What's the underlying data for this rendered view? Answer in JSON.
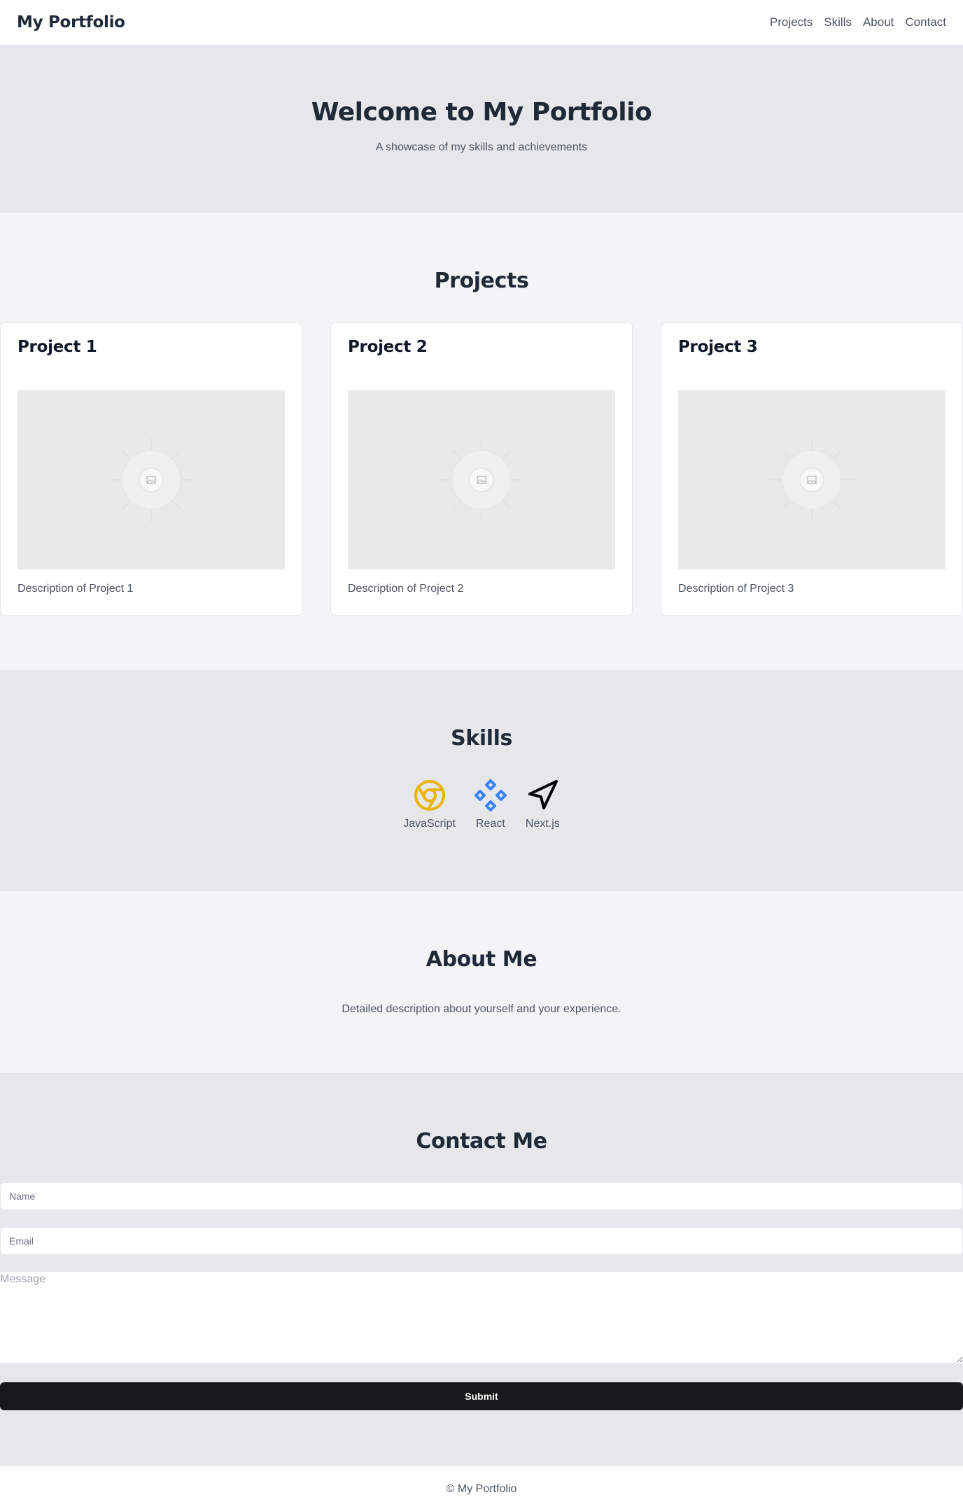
{
  "header": {
    "brand": "My Portfolio",
    "nav": [
      "Projects",
      "Skills",
      "About",
      "Contact"
    ]
  },
  "hero": {
    "title": "Welcome to My Portfolio",
    "subtitle": "A showcase of my skills and achievements"
  },
  "projects": {
    "title": "Projects",
    "items": [
      {
        "title": "Project 1",
        "description": "Description of Project 1",
        "image_icon": "image-placeholder-icon"
      },
      {
        "title": "Project 2",
        "description": "Description of Project 2",
        "image_icon": "image-placeholder-icon"
      },
      {
        "title": "Project 3",
        "description": "Description of Project 3",
        "image_icon": "image-placeholder-icon"
      }
    ]
  },
  "skills": {
    "title": "Skills",
    "items": [
      {
        "label": "JavaScript",
        "icon": "chrome-icon",
        "color": "#eab308"
      },
      {
        "label": "React",
        "icon": "diamonds-icon",
        "color": "#3b82f6"
      },
      {
        "label": "Next.js",
        "icon": "navigation-arrow-icon",
        "color": "#000000"
      }
    ]
  },
  "about": {
    "title": "About Me",
    "text": "Detailed description about yourself and your experience."
  },
  "contact": {
    "title": "Contact Me",
    "name_placeholder": "Name",
    "email_placeholder": "Email",
    "message_placeholder": "Message",
    "submit_label": "Submit"
  },
  "footer": {
    "text": "© My Portfolio"
  },
  "colors": {
    "header_bg": "#ffffff",
    "hero_bg": "#e5e7eb",
    "section_alt_bg": "#f3f4f6",
    "heading": "#1f2937",
    "body_text": "#4b5563",
    "button_bg": "#18181b"
  }
}
